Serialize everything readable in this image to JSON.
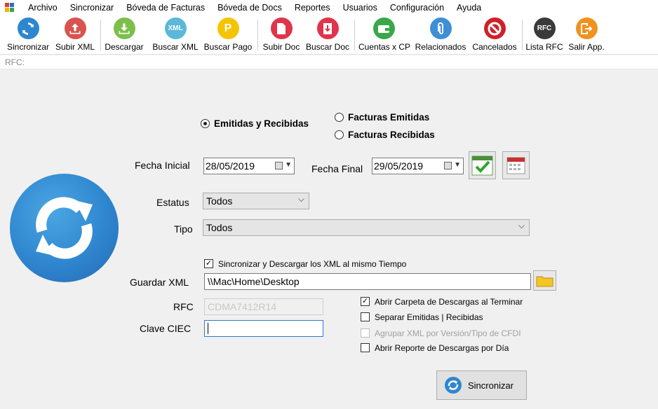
{
  "menu": [
    "Archivo",
    "Sincronizar",
    "Bóveda de Facturas",
    "Bóveda de Docs",
    "Reportes",
    "Usuarios",
    "Configuración",
    "Ayuda"
  ],
  "toolbar": {
    "sincronizar": "Sincronizar",
    "subir_xml": "Subir XML",
    "descargar": "Descargar",
    "buscar_xml": "Buscar XML",
    "buscar_pago": "Buscar Pago",
    "subir_doc": "Subir Doc",
    "buscar_doc": "Buscar Doc",
    "cuentas_cp": "Cuentas x CP",
    "relacionados": "Relacionados",
    "cancelados": "Cancelados",
    "lista_rfc": "Lista RFC",
    "salir": "Salir App.",
    "xml_glyph": "XML",
    "p_glyph": "P",
    "rfc_glyph": "RFC"
  },
  "rfc_bar": {
    "label": "RFC:"
  },
  "form": {
    "radio_both": "Emitidas y Recibidas",
    "radio_emitidas": "Facturas Emitidas",
    "radio_recibidas": "Facturas Recibidas",
    "fecha_inicial_label": "Fecha Inicial",
    "fecha_inicial": "28/05/2019",
    "fecha_final_label": "Fecha Final",
    "fecha_final": "29/05/2019",
    "estatus_label": "Estatus",
    "estatus_value": "Todos",
    "tipo_label": "Tipo",
    "tipo_value": "Todos",
    "sync_download_check": "Sincronizar y Descargar los XML al mismo Tiempo",
    "guardar_label": "Guardar XML",
    "guardar_value": "\\\\Mac\\Home\\Desktop",
    "rfc_label": "RFC",
    "rfc_value": "CDMA7412R14",
    "clave_label": "Clave CIEC",
    "clave_value": "",
    "opt_abrir": "Abrir Carpeta de Descargas al Terminar",
    "opt_separar": "Separar Emitidas | Recibidas",
    "opt_agrupar": "Agrupar XML por Versión/Tipo de CFDI",
    "opt_reporte": "Abrir Reporte de Descargas por Día",
    "sync_button": "Sincronizar"
  },
  "colors": {
    "accent_blue": "#2f86cf",
    "red": "#d9534f",
    "green": "#3aa84a",
    "yellow": "#f5c400",
    "orange": "#f0921e",
    "dark": "#3a3a3a"
  }
}
